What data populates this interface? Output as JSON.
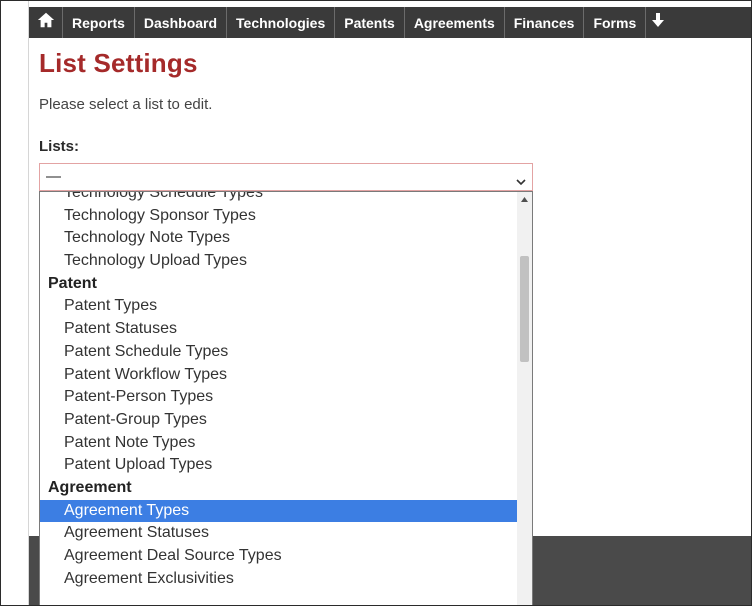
{
  "nav": {
    "home_icon": "home-icon",
    "items": [
      "Reports",
      "Dashboard",
      "Technologies",
      "Patents",
      "Agreements",
      "Finances",
      "Forms"
    ],
    "more_icon": "arrow-down-icon"
  },
  "page": {
    "title": "List Settings",
    "instructions": "Please select a list to edit.",
    "lists_label": "Lists:"
  },
  "select": {
    "selected_value": "—",
    "options": [
      {
        "type": "option",
        "label": "Technology Schedule Types"
      },
      {
        "type": "option",
        "label": "Technology Sponsor Types"
      },
      {
        "type": "option",
        "label": "Technology Note Types"
      },
      {
        "type": "option",
        "label": "Technology Upload Types"
      },
      {
        "type": "group",
        "label": "Patent"
      },
      {
        "type": "option",
        "label": "Patent Types"
      },
      {
        "type": "option",
        "label": "Patent Statuses"
      },
      {
        "type": "option",
        "label": "Patent Schedule Types"
      },
      {
        "type": "option",
        "label": "Patent Workflow Types"
      },
      {
        "type": "option",
        "label": "Patent-Person Types"
      },
      {
        "type": "option",
        "label": "Patent-Group Types"
      },
      {
        "type": "option",
        "label": "Patent Note Types"
      },
      {
        "type": "option",
        "label": "Patent Upload Types"
      },
      {
        "type": "group",
        "label": "Agreement"
      },
      {
        "type": "option",
        "label": "Agreement Types",
        "selected": true
      },
      {
        "type": "option",
        "label": "Agreement Statuses"
      },
      {
        "type": "option",
        "label": "Agreement Deal Source Types"
      },
      {
        "type": "option",
        "label": "Agreement Exclusivities"
      }
    ]
  },
  "colors": {
    "title": "#a52a2a",
    "navbar": "#3a3a3a",
    "highlight": "#3c7ee3"
  }
}
